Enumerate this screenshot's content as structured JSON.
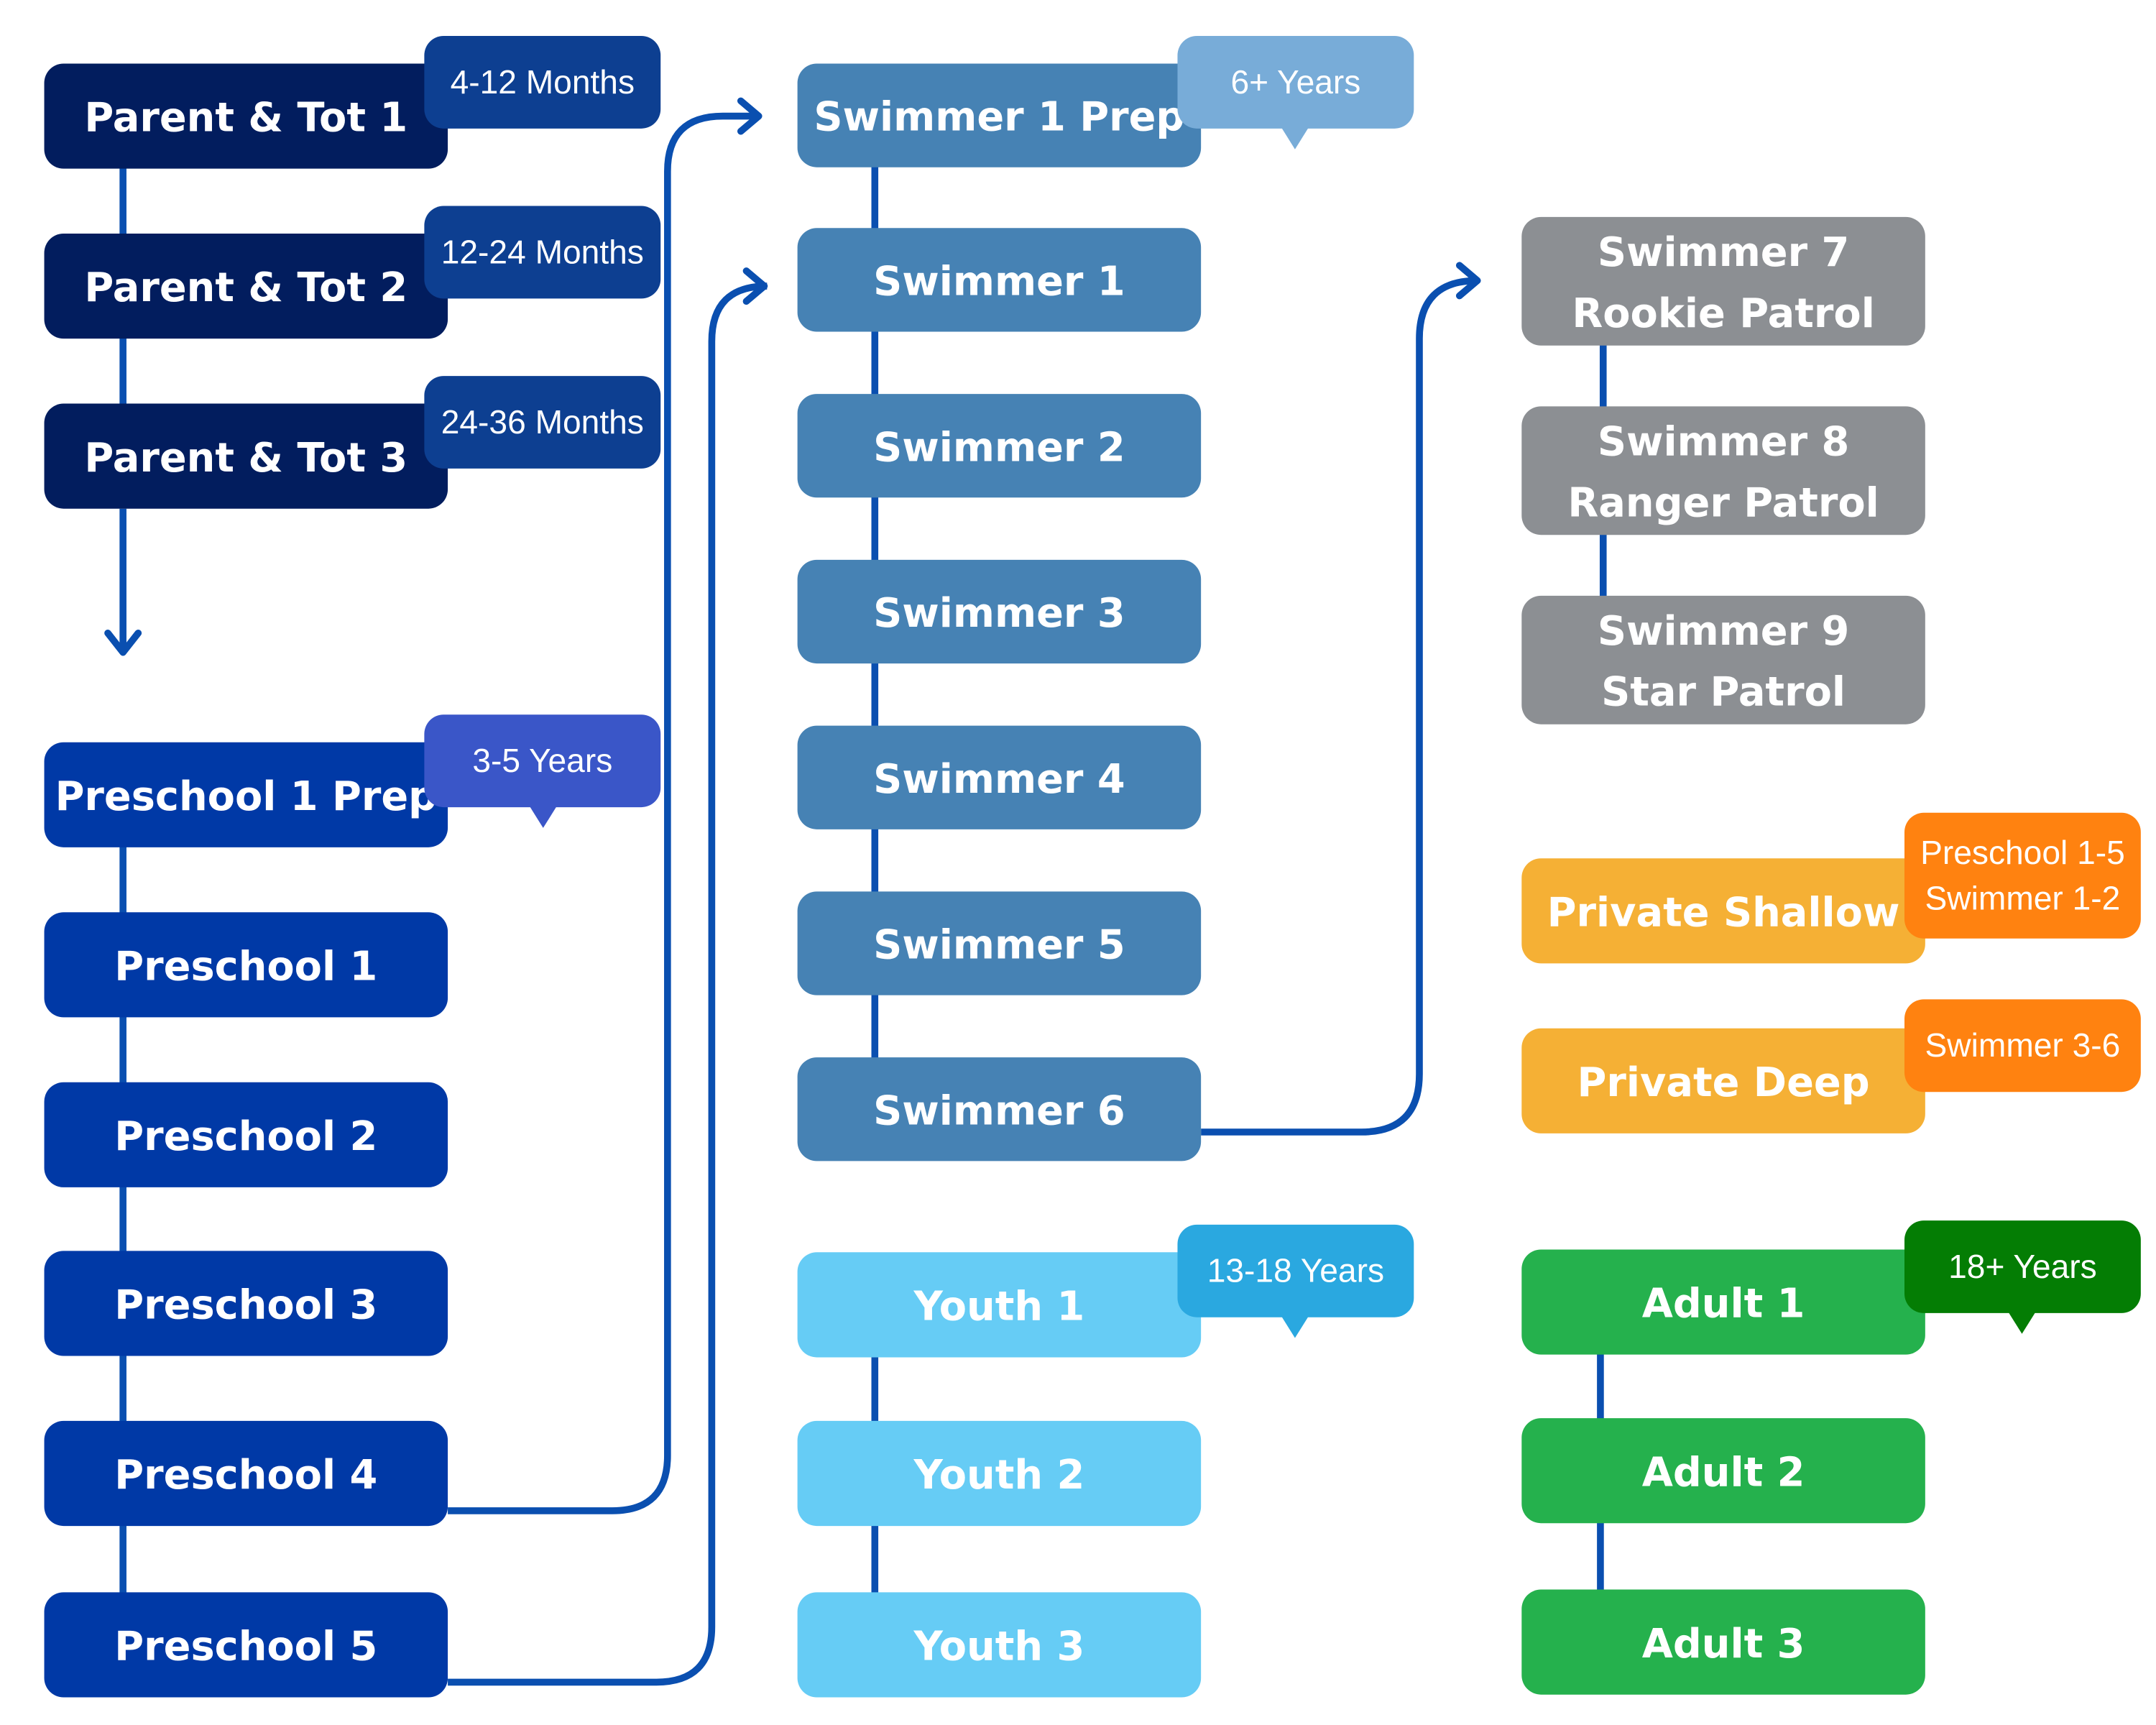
{
  "colors": {
    "connector": "#0a4fb0",
    "parent_tot": "#021d5e",
    "parent_tot_badge": "#0d3f91",
    "preschool": "#0039a6",
    "preschool_badge": "#3a56c8",
    "swimmer": "#4682b4",
    "swimmer_badge": "#78acd8",
    "youth": "#66ccf5",
    "youth_badge": "#2aa8e0",
    "patrol": "#8c8f93",
    "private": "#f5b035",
    "private_badge": "#ff8210",
    "adult": "#25b14d",
    "adult_badge": "#047d04"
  },
  "levels": {
    "parent_tot": [
      {
        "label": [
          "Parent & Tot 1"
        ],
        "badge": [
          "4-12 Months"
        ]
      },
      {
        "label": [
          "Parent & Tot 2"
        ],
        "badge": [
          "12-24 Months"
        ]
      },
      {
        "label": [
          "Parent & Tot 3"
        ],
        "badge": [
          "24-36 Months"
        ]
      }
    ],
    "preschool": [
      {
        "label": [
          "Preschool 1 Prep"
        ],
        "badge": [
          "3-5 Years"
        ]
      },
      {
        "label": [
          "Preschool 1"
        ]
      },
      {
        "label": [
          "Preschool 2"
        ]
      },
      {
        "label": [
          "Preschool 3"
        ]
      },
      {
        "label": [
          "Preschool 4"
        ]
      },
      {
        "label": [
          "Preschool 5"
        ]
      }
    ],
    "swimmer": [
      {
        "label": [
          "Swimmer 1 Prep"
        ],
        "badge": [
          "6+ Years"
        ]
      },
      {
        "label": [
          "Swimmer 1"
        ]
      },
      {
        "label": [
          "Swimmer 2"
        ]
      },
      {
        "label": [
          "Swimmer 3"
        ]
      },
      {
        "label": [
          "Swimmer 4"
        ]
      },
      {
        "label": [
          "Swimmer 5"
        ]
      },
      {
        "label": [
          "Swimmer 6"
        ]
      }
    ],
    "youth": [
      {
        "label": [
          "Youth 1"
        ],
        "badge": [
          "13-18 Years"
        ]
      },
      {
        "label": [
          "Youth 2"
        ]
      },
      {
        "label": [
          "Youth 3"
        ]
      }
    ],
    "patrol": [
      {
        "label": [
          "Swimmer 7",
          "Rookie Patrol"
        ]
      },
      {
        "label": [
          "Swimmer 8",
          "Ranger Patrol"
        ]
      },
      {
        "label": [
          "Swimmer 9",
          "Star Patrol"
        ]
      }
    ],
    "private": [
      {
        "label": [
          "Private Shallow"
        ],
        "badge": [
          "Preschool 1-5",
          "Swimmer 1-2"
        ]
      },
      {
        "label": [
          "Private Deep"
        ],
        "badge": [
          "Swimmer 3-6"
        ]
      }
    ],
    "adult": [
      {
        "label": [
          "Adult 1"
        ],
        "badge": [
          "18+ Years"
        ]
      },
      {
        "label": [
          "Adult 2"
        ]
      },
      {
        "label": [
          "Adult 3"
        ]
      }
    ]
  }
}
